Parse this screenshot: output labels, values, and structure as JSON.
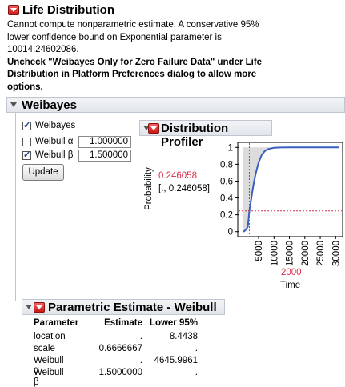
{
  "life_distribution": {
    "title": "Life Distribution",
    "message_lines": [
      "Cannot compute nonparametric estimate. A conservative 95%",
      "lower confidence bound on Exponential parameter is",
      "10014.24602086."
    ],
    "uncheck_lines": [
      "Uncheck \"Weibayes Only for Zero Failure Data\" under Life",
      "Distribution in Platform Preferences dialog to allow more",
      "options."
    ]
  },
  "weibayes": {
    "title": "Weibayes",
    "checkbox_label": "Weibayes",
    "alpha_label": "Weibull α",
    "alpha_value": "1.000000",
    "beta_label": "Weibull β",
    "beta_value": "1.500000",
    "update_label": "Update"
  },
  "profiler": {
    "title": "Distribution Profiler",
    "ylabel": "Probability",
    "current_value": "0.246058",
    "interval": "[., 0.246058]",
    "xlabel": "Time",
    "current_x": "2000",
    "colors": {
      "curve": "#3a5fc0",
      "crosshair": "#d6304a",
      "band": "#d9d9d9"
    }
  },
  "parametric": {
    "title": "Parametric Estimate - Weibull",
    "headers": [
      "Parameter",
      "Estimate",
      "Lower 95%"
    ],
    "rows": [
      [
        "location",
        ".",
        "8.4438"
      ],
      [
        "scale",
        "0.6666667",
        "."
      ],
      [
        "Weibull α",
        ".",
        "4645.9961"
      ],
      [
        "Weibull β",
        "1.5000000",
        "."
      ]
    ]
  },
  "chart_data": {
    "type": "line",
    "xlabel": "Time",
    "ylabel": "Probability",
    "xlim": [
      -1500,
      32000
    ],
    "ylim": [
      -0.05,
      1.05
    ],
    "x_ticks": [
      "5000",
      "10000",
      "15000",
      "20000",
      "25000",
      "30000"
    ],
    "y_ticks": [
      "0",
      "0.2",
      "0.4",
      "0.6",
      "0.8",
      "1"
    ],
    "series": [
      {
        "x": [
          0,
          500,
          1000,
          1500,
          2000,
          2500,
          3000,
          3500,
          4000,
          5000,
          6000,
          7000,
          8000,
          10000,
          12000,
          15000,
          20000,
          25000,
          31000
        ],
        "y": [
          0.0,
          0.01,
          0.03,
          0.06,
          0.246,
          0.36,
          0.48,
          0.59,
          0.68,
          0.82,
          0.91,
          0.955,
          0.98,
          0.995,
          0.999,
          1.0,
          1.0,
          1.0,
          1.0
        ]
      }
    ],
    "crosshair": {
      "x": 2000,
      "y": 0.246058
    }
  }
}
